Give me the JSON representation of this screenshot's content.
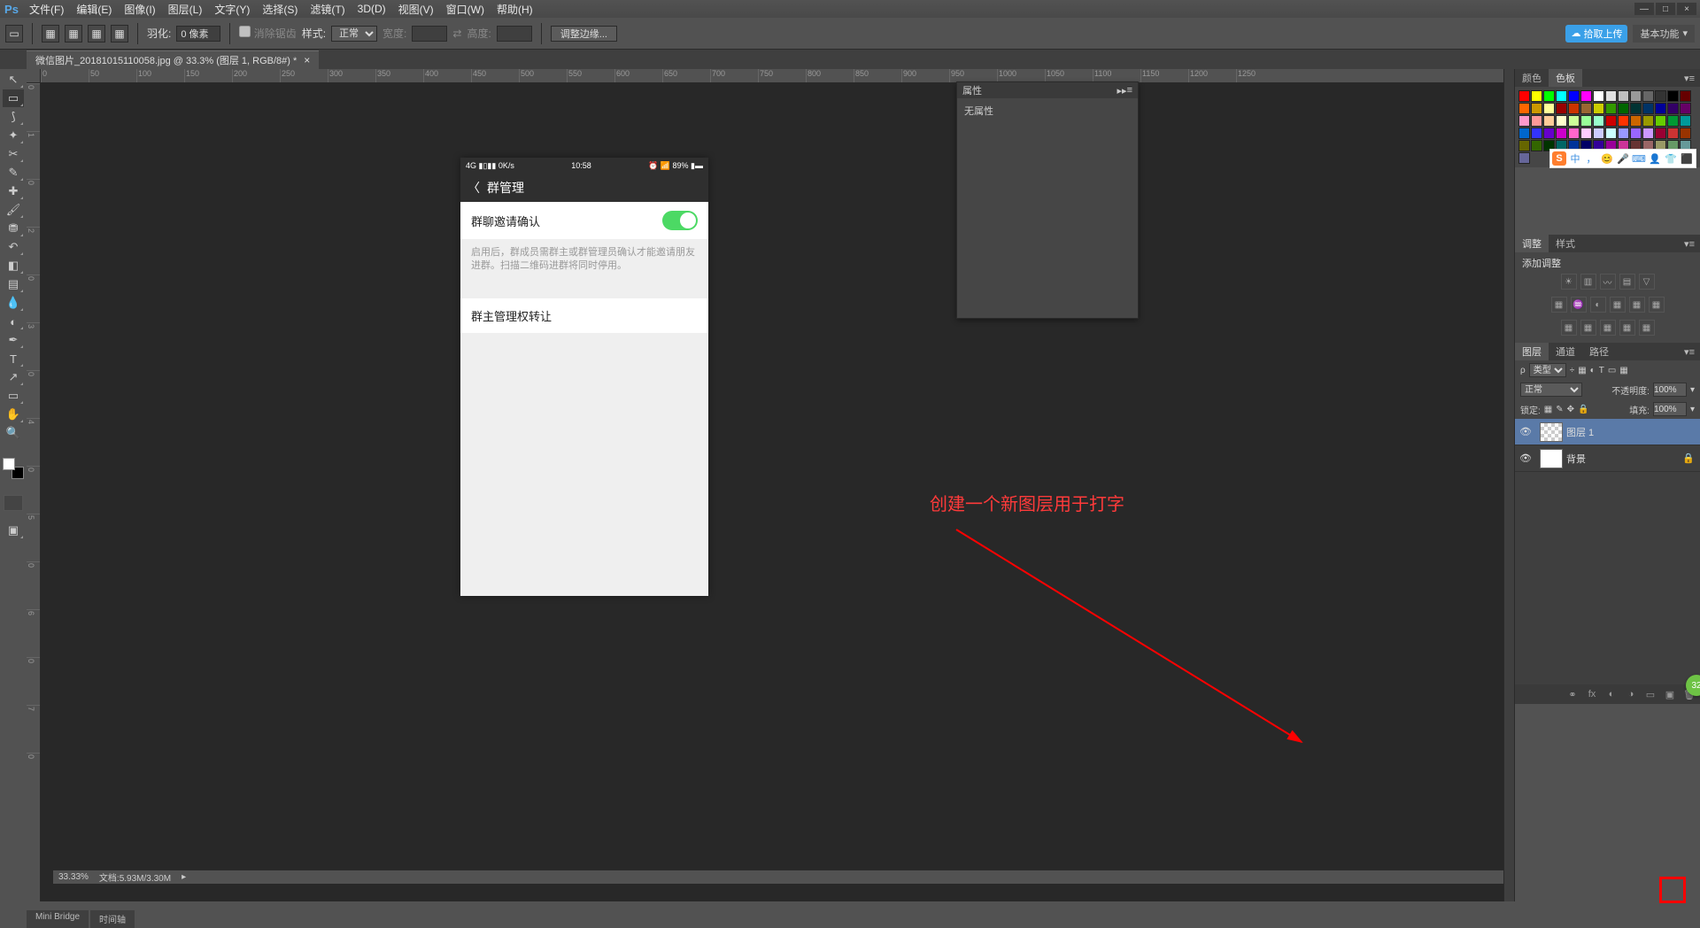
{
  "app": {
    "logo": "Ps"
  },
  "menu": [
    "文件(F)",
    "编辑(E)",
    "图像(I)",
    "图层(L)",
    "文字(Y)",
    "选择(S)",
    "滤镜(T)",
    "3D(D)",
    "视图(V)",
    "窗口(W)",
    "帮助(H)"
  ],
  "win_controls": [
    "—",
    "□",
    "×"
  ],
  "options": {
    "feather_label": "羽化:",
    "feather_value": "0 像素",
    "antialias": "消除锯齿",
    "style_label": "样式:",
    "style_value": "正常",
    "width_label": "宽度:",
    "height_label": "高度:",
    "refine": "调整边缘...",
    "cloud": "拾取上传",
    "workspace": "基本功能"
  },
  "doctab": {
    "title": "微信图片_20181015110058.jpg @ 33.3% (图层 1, RGB/8#) *"
  },
  "ruler_h": [
    "0",
    "50",
    "100",
    "150",
    "200",
    "250",
    "300",
    "350",
    "400",
    "450",
    "500",
    "550",
    "600",
    "650",
    "700",
    "750",
    "800",
    "850",
    "900",
    "950",
    "1000",
    "1050",
    "1100",
    "1150",
    "1200",
    "1250"
  ],
  "ruler_v": [
    "0",
    "1",
    "0",
    "2",
    "0",
    "3",
    "0",
    "4",
    "0",
    "5",
    "0",
    "6",
    "0",
    "7",
    "0"
  ],
  "phone": {
    "signal": "4G ▮▯▮▮ 0K/s",
    "time": "10:58",
    "battery": "⏰ 📶 89% ▮▬",
    "back": "〈",
    "title": "群管理",
    "row1": "群聊邀请确认",
    "desc": "启用后，群成员需群主或群管理员确认才能邀请朋友进群。扫描二维码进群将同时停用。",
    "row2": "群主管理权转让"
  },
  "annotation": "创建一个新图层用于打字",
  "status": {
    "zoom": "33.33%",
    "doc": "文档:5.93M/3.30M"
  },
  "bottom_tabs": [
    "Mini Bridge",
    "时间轴"
  ],
  "prop_panel": {
    "title": "属性",
    "body": "无属性"
  },
  "swatch_tabs": [
    "颜色",
    "色板"
  ],
  "swatch_colors": [
    "#ff0000",
    "#ffff00",
    "#00ff00",
    "#00ffff",
    "#0000ff",
    "#ff00ff",
    "#ffffff",
    "#e0e0e0",
    "#c0c0c0",
    "#999999",
    "#666666",
    "#333333",
    "#000000",
    "#660000",
    "#ff6600",
    "#cc9900",
    "#ffff99",
    "#990000",
    "#cc3300",
    "#996633",
    "#cccc00",
    "#339900",
    "#006600",
    "#003333",
    "#003366",
    "#000099",
    "#330066",
    "#660066",
    "#ff99cc",
    "#ff9999",
    "#ffcc99",
    "#ffffcc",
    "#ccff99",
    "#99ff99",
    "#99ffcc",
    "#cc0000",
    "#ff3300",
    "#cc6600",
    "#999900",
    "#66cc00",
    "#009933",
    "#009999",
    "#0066cc",
    "#3333ff",
    "#6600cc",
    "#cc00cc",
    "#ff66cc",
    "#ffccff",
    "#ccccff",
    "#ccffff",
    "#9999ff",
    "#9966ff",
    "#cc99ff",
    "#990033",
    "#cc3333",
    "#993300",
    "#666600",
    "#336600",
    "#003300",
    "#006666",
    "#003399",
    "#000066",
    "#330099",
    "#990099",
    "#cc3399",
    "#663333",
    "#996666",
    "#999966",
    "#669966",
    "#669999",
    "#666699"
  ],
  "adjust_tabs": [
    "调整",
    "样式"
  ],
  "adjust_label": "添加调整",
  "layer_tabs": [
    "图层",
    "通道",
    "路径"
  ],
  "layer_filter": "类型",
  "layer_blend": "正常",
  "opacity_label": "不透明度:",
  "opacity": "100%",
  "lock_label": "锁定:",
  "fill_label": "填充:",
  "fill": "100%",
  "layers": [
    {
      "name": "图层 1",
      "checker": true,
      "selected": true
    },
    {
      "name": "背景",
      "checker": false,
      "selected": false,
      "locked": true
    }
  ],
  "sogou": [
    "中",
    "，",
    "😊",
    "🎤",
    "⌨",
    "👤",
    "👕",
    "⬛"
  ]
}
